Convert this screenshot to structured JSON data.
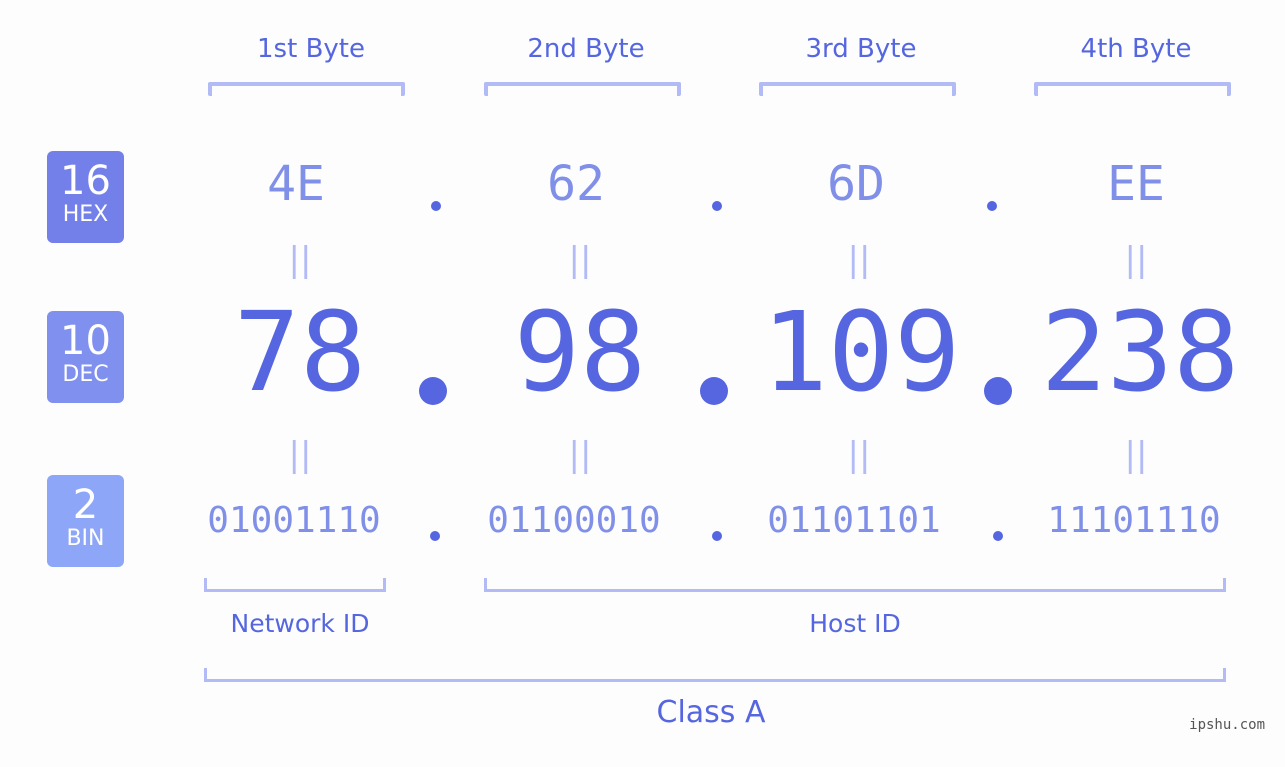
{
  "bytes": [
    {
      "label": "1st Byte",
      "hex": "4E",
      "dec": "78",
      "bin": "01001110"
    },
    {
      "label": "2nd Byte",
      "hex": "62",
      "dec": "98",
      "bin": "01100010"
    },
    {
      "label": "3rd Byte",
      "hex": "6D",
      "dec": "109",
      "bin": "01101101"
    },
    {
      "label": "4th Byte",
      "hex": "EE",
      "dec": "238",
      "bin": "11101110"
    }
  ],
  "rows": {
    "hex": {
      "base": "16",
      "name": "HEX",
      "color": "#7480ea"
    },
    "dec": {
      "base": "10",
      "name": "DEC",
      "color": "#8090ee"
    },
    "bin": {
      "base": "2",
      "name": "BIN",
      "color": "#8ea6f8"
    }
  },
  "equals_symbol": "||",
  "separator": ".",
  "network_id_label": "Network ID",
  "host_id_label": "Host ID",
  "class_label": "Class A",
  "watermark": "ipshu.com"
}
